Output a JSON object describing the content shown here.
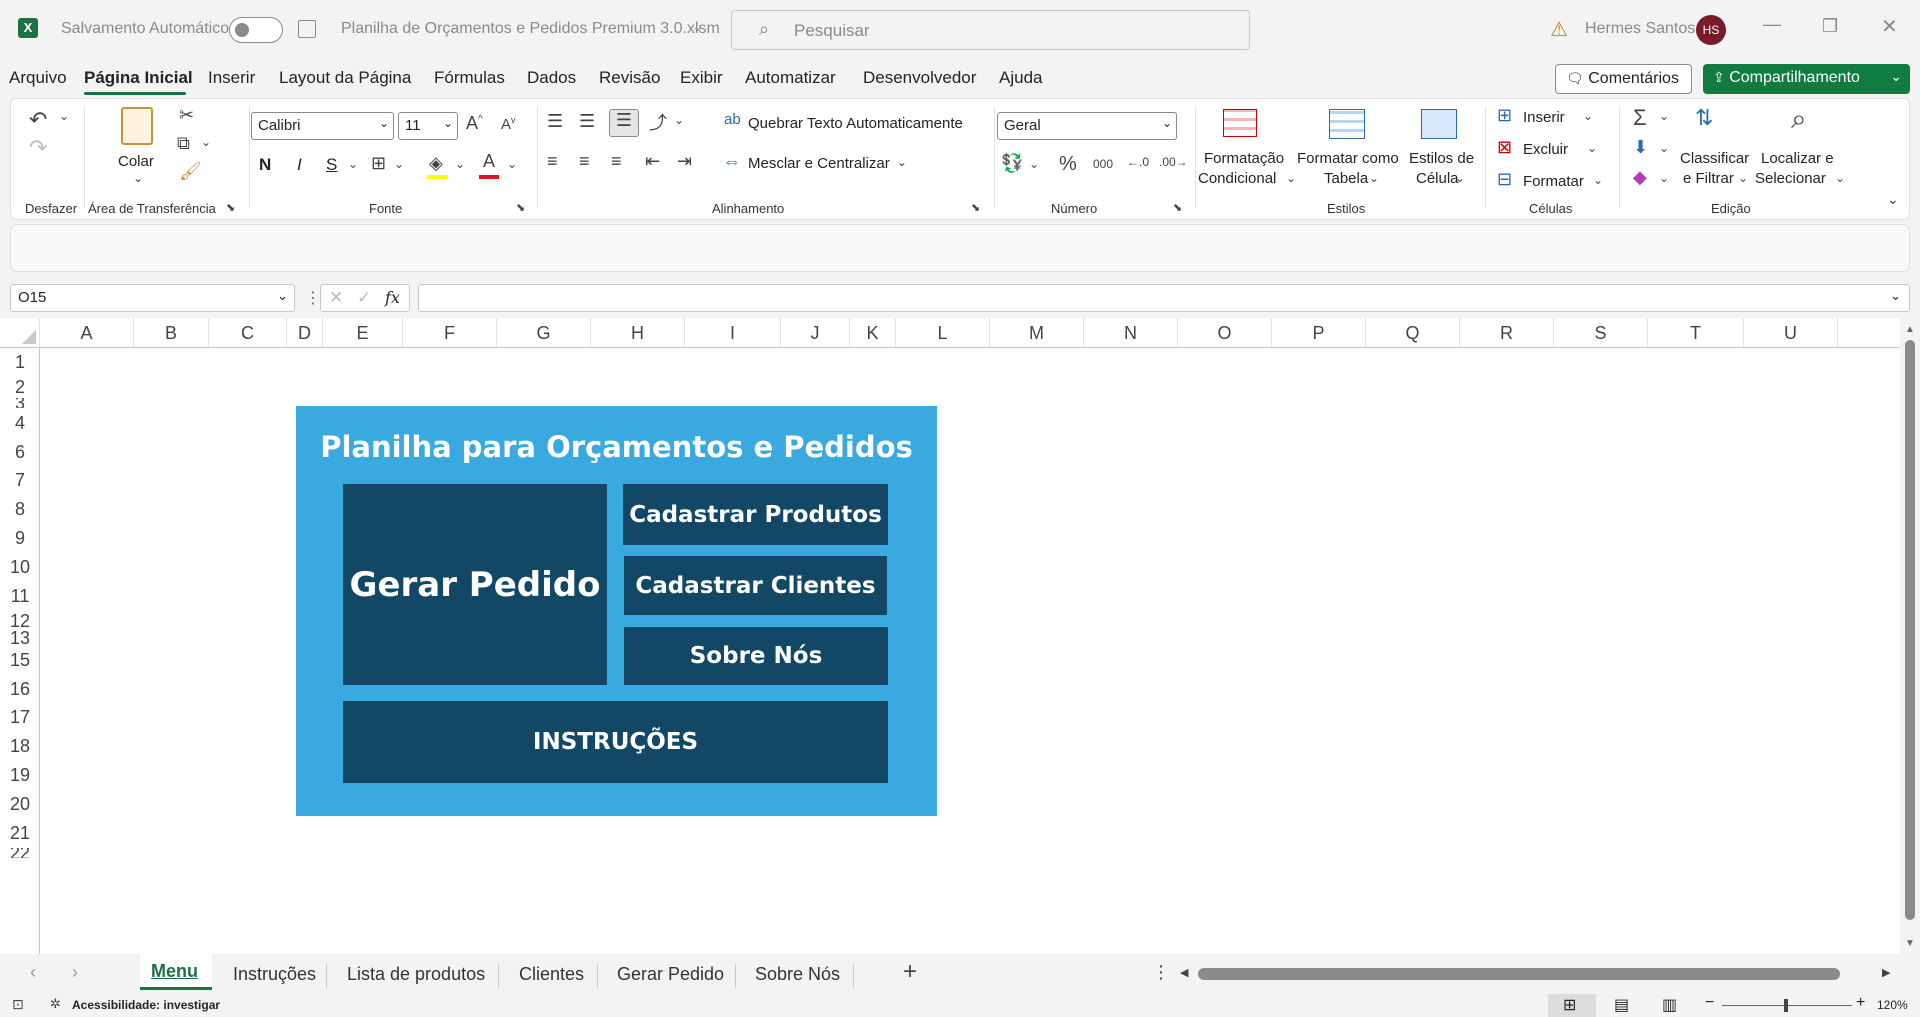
{
  "window": {
    "autosave_label": "Salvamento Automático",
    "file_name": "Planilha de Orçamentos e Pedidos Premium 3.0.xlsm",
    "search_placeholder": "Pesquisar",
    "user_name": "Hermes Santos",
    "user_initials": "HS"
  },
  "menu": {
    "items": [
      "Arquivo",
      "Página Inicial",
      "Inserir",
      "Layout da Página",
      "Fórmulas",
      "Dados",
      "Revisão",
      "Exibir",
      "Automatizar",
      "Desenvolvedor",
      "Ajuda"
    ],
    "comments_label": "Comentários",
    "share_label": "Compartilhamento"
  },
  "ribbon": {
    "undo_group": "Desfazer",
    "clipboard_group": "Área de Transferência",
    "paste_label": "Colar",
    "font_group": "Fonte",
    "font_name": "Calibri",
    "font_size": "11",
    "bold": "N",
    "italic": "I",
    "underline": "S",
    "align_group": "Alinhamento",
    "wrap_text": "Quebrar Texto Automaticamente",
    "merge_center": "Mesclar e Centralizar",
    "number_group": "Número",
    "number_format": "Geral",
    "styles_group": "Estilos",
    "cond_format_1": "Formatação",
    "cond_format_2": "Condicional",
    "format_table_1": "Formatar como",
    "format_table_2": "Tabela",
    "cell_styles_1": "Estilos de",
    "cell_styles_2": "Célula",
    "cells_group": "Células",
    "insert": "Inserir",
    "delete": "Excluir",
    "format": "Formatar",
    "editing_group": "Edição",
    "sort_filter_1": "Classificar",
    "sort_filter_2": "e Filtrar",
    "find_select_1": "Localizar e",
    "find_select_2": "Selecionar"
  },
  "formula_bar": {
    "name_box": "O15",
    "fx": "fx",
    "content": ""
  },
  "columns": [
    "A",
    "B",
    "C",
    "D",
    "E",
    "F",
    "G",
    "H",
    "I",
    "J",
    "K",
    "L",
    "M",
    "N",
    "O",
    "P",
    "Q",
    "R",
    "S",
    "T",
    "U"
  ],
  "rows": [
    "1",
    "2",
    "3",
    "4",
    "6",
    "7",
    "8",
    "9",
    "10",
    "11",
    "12",
    "13",
    "15",
    "16",
    "17",
    "18",
    "19",
    "20",
    "21",
    "22"
  ],
  "menu_panel": {
    "title": "Planilha para Orçamentos e Pedidos",
    "gerar_pedido": "Gerar Pedido",
    "cadastrar_produtos": "Cadastrar Produtos",
    "cadastrar_clientes": "Cadastrar Clientes",
    "sobre_nos": "Sobre Nós",
    "instrucoes": "INSTRUÇÕES",
    "bg_color": "#39a9e0",
    "button_color": "#124866"
  },
  "sheets": {
    "tabs": [
      "Menu",
      "Instruções",
      "Lista de produtos",
      "Clientes",
      "Gerar Pedido",
      "Sobre Nós"
    ],
    "active": "Menu"
  },
  "status": {
    "accessibility": "Acessibilidade: investigar",
    "zoom": "120%"
  },
  "colors": {
    "excel_green": "#1e7145",
    "share_green": "#107c41",
    "avatar": "#7a1b2a"
  }
}
